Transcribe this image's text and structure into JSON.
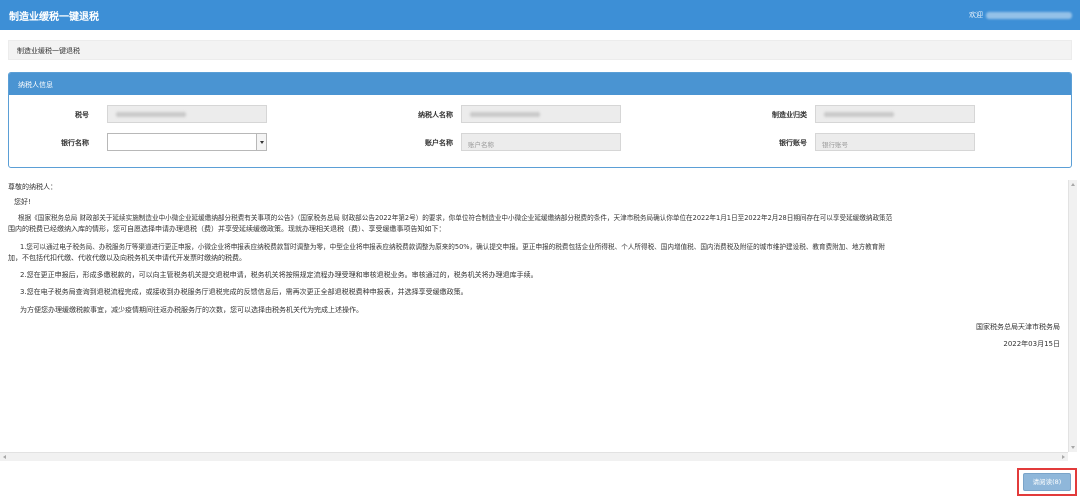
{
  "header": {
    "title": "制造业缓税一键退税",
    "welcome_label": "欢迎"
  },
  "breadcrumb": {
    "label": "制造业缓税一键退税"
  },
  "taxpayer_panel": {
    "title": "纳税人信息",
    "fields": {
      "tax_id": {
        "label": "税号"
      },
      "taxpayer_name": {
        "label": "纳税人名称"
      },
      "industry_category": {
        "label": "制造业归类"
      },
      "bank_name": {
        "label": "银行名称",
        "value": ""
      },
      "account_name": {
        "label": "账户名称",
        "placeholder": "账户名称"
      },
      "bank_account": {
        "label": "银行账号",
        "placeholder": "银行账号"
      }
    }
  },
  "letter": {
    "salutation": "尊敬的纳税人：",
    "greeting": "您好!",
    "para1_line1": "根据《国家税务总局 财政部关于延续实施制造业中小微企业延缓缴纳部分税费有关事项的公告》（国家税务总局 财政部公告2022年第2号）的要求，你单位符合制造业中小微企业延缓缴纳部分税费的条件，天津市税务局确认你单位在2022年1月1日至2022年2月28日期间存在可以享受延缓缴纳政策范",
    "para1_line2": "围内的税费已经缴纳入库的情形，您可自愿选择申请办理退税（费）并享受延续缓缴政策。现就办理相关退税（费）、享受缓缴事项告知如下：",
    "item1_line1": "1.您可以通过电子税务局、办税服务厅等渠道进行更正申报，小微企业将申报表应纳税费款暂时调整为零，中型企业将申报表应纳税费款调整为原来的50%，确认提交申报。更正申报的税费包括企业所得税、个人所得税、国内增值税、国内消费税及附征的城市维护建设税、教育费附加、地方教育附",
    "item1_line2": "加，不包括代扣代缴、代收代缴以及向税务机关申请代开发票时缴纳的税费。",
    "item2": "2.您在更正申报后，形成多缴税款的，可以向主管税务机关提交退税申请，税务机关将按照规定流程办理受理和审核退税业务。审核通过的，税务机关将办理退库手续。",
    "item3": "3.您在电子税务局查询到退税流程完成，或接收到办税服务厅退税完成的反馈信息后，需再次更正全部退税税费种申报表，并选择享受缓缴政策。",
    "closing": "为方便您办理缓缴税款事宜，减少疫情期间往返办税服务厅的次数，您可以选择由税务机关代为完成上述操作。",
    "signature": "国家税务总局天津市税务局",
    "date": "2022年03月15日"
  },
  "actions": {
    "apply_label": "请阅读(8)"
  }
}
